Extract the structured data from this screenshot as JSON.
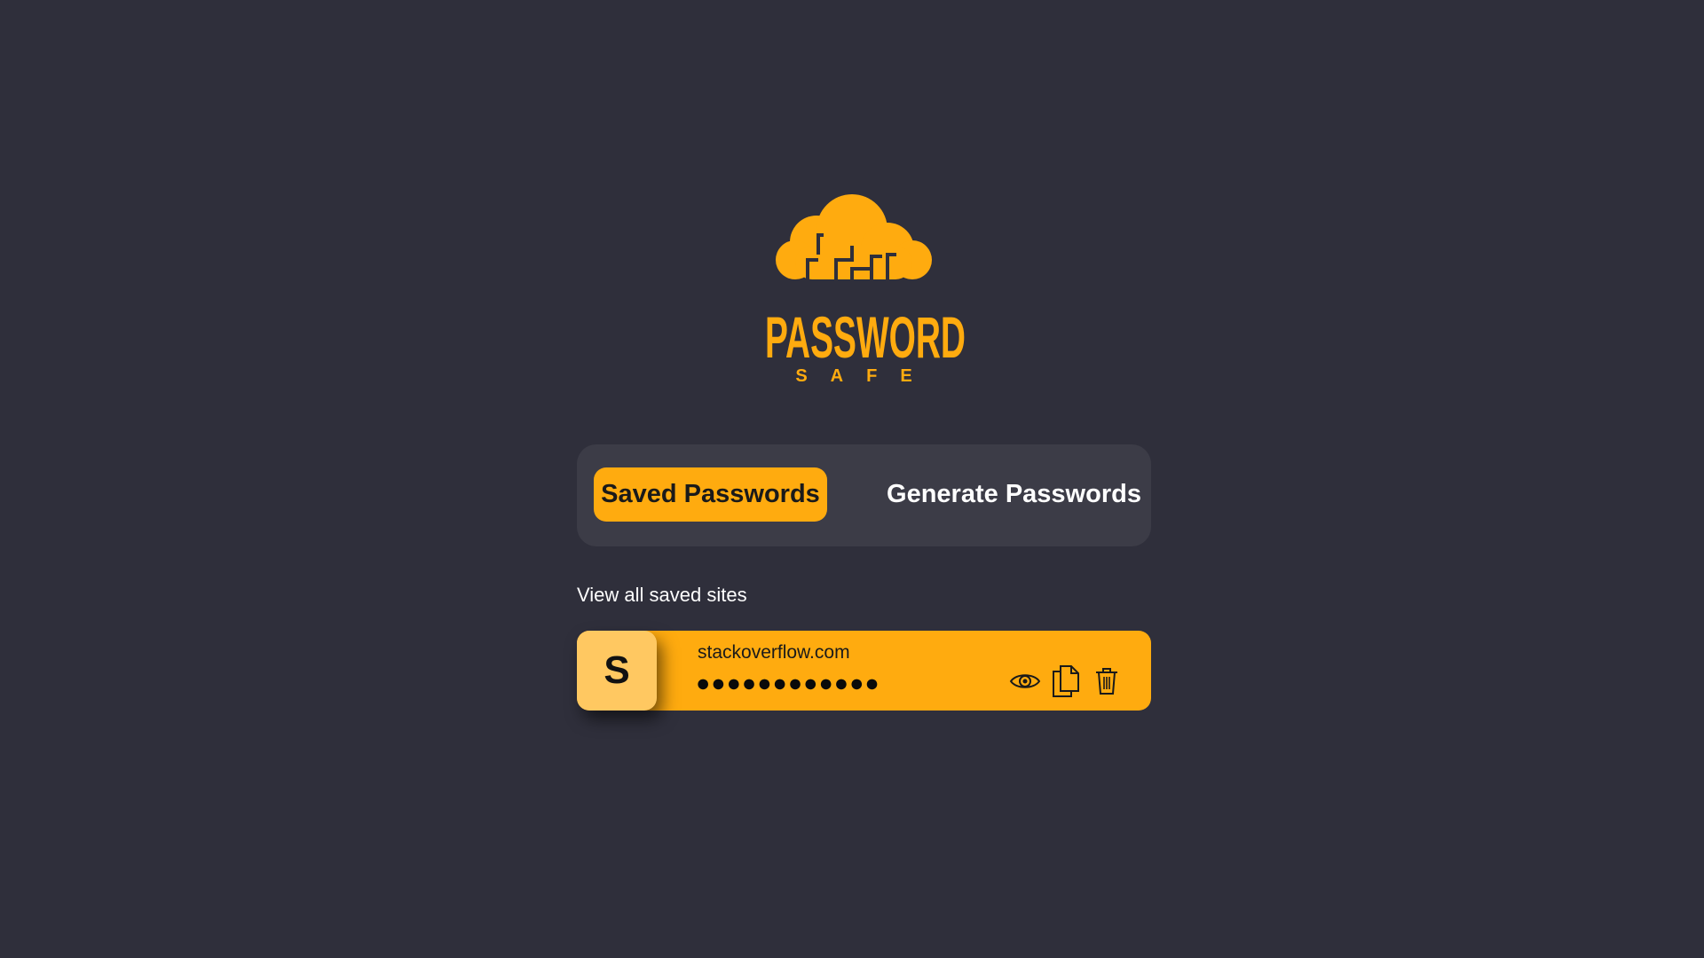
{
  "brand": {
    "name": "PASSWORD",
    "subtitle": "SAFE",
    "color": "#ffab0f"
  },
  "tabs": [
    {
      "label": "Saved Passwords",
      "active": true
    },
    {
      "label": "Generate Passwords",
      "active": false
    }
  ],
  "section": {
    "label": "View all saved sites"
  },
  "entries": [
    {
      "initial": "S",
      "site": "stackoverflow.com",
      "password_mask": "●●●●●●●●●●●●",
      "actions": [
        "eye-icon",
        "copy-icon",
        "trash-icon"
      ]
    }
  ],
  "colors": {
    "background": "#2f2f3b",
    "panel": "#3c3c47",
    "accent": "#ffab0f",
    "avatar": "#ffc861"
  }
}
